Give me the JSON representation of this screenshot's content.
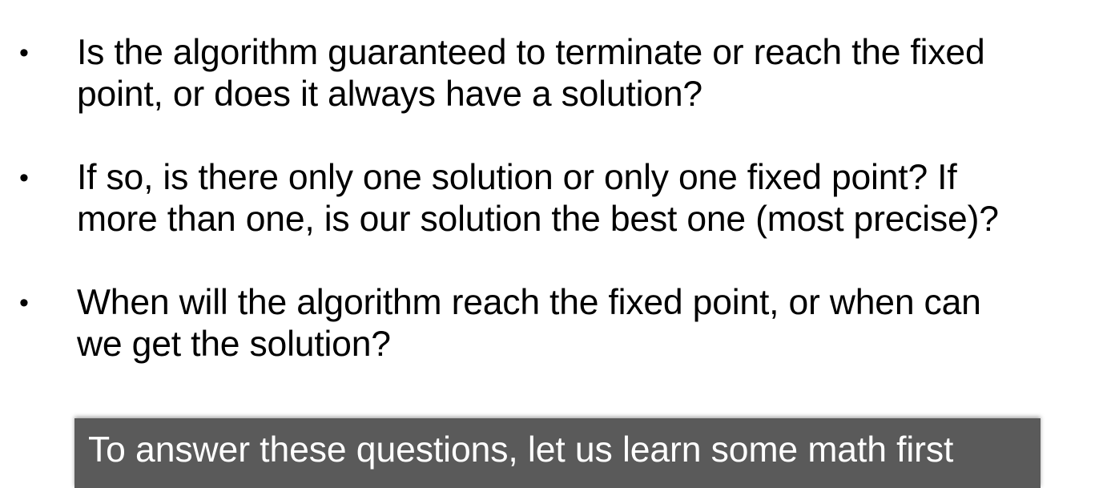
{
  "bullets": [
    {
      "marker": "•",
      "text": "Is the algorithm guaranteed to terminate or reach the fixed\npoint, or does it always have a solution?"
    },
    {
      "marker": "•",
      "text": "If so, is there only one solution or only one fixed point? If\nmore than one, is our solution the best one (most precise)?"
    },
    {
      "marker": "•",
      "text": "When will the algorithm reach the fixed point, or when can\nwe get the solution?"
    }
  ],
  "callout": {
    "text": "To answer these questions, let us learn some math first",
    "background_color": "#5a5a5a",
    "text_color": "#ffffff"
  }
}
